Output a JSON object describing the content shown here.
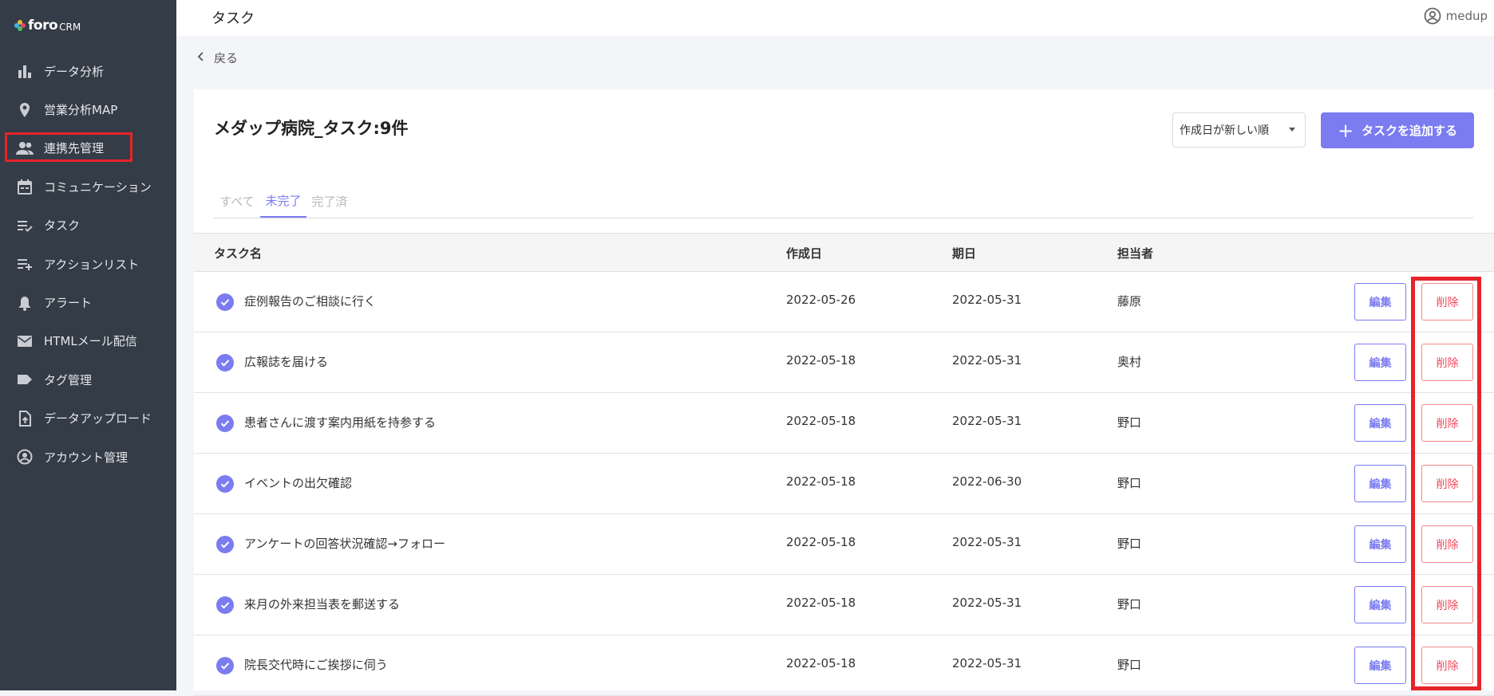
{
  "app": {
    "logo_word": "foro",
    "logo_sub": "CRM"
  },
  "sidebar": {
    "items": [
      {
        "label": "データ分析",
        "icon": "bar-chart-icon"
      },
      {
        "label": "営業分析MAP",
        "icon": "map-pin-icon"
      },
      {
        "label": "連携先管理",
        "icon": "people-icon"
      },
      {
        "label": "コミュニケーション",
        "icon": "calendar-icon"
      },
      {
        "label": "タスク",
        "icon": "checklist-icon"
      },
      {
        "label": "アクションリスト",
        "icon": "playlist-add-icon"
      },
      {
        "label": "アラート",
        "icon": "bell-icon"
      },
      {
        "label": "HTMLメール配信",
        "icon": "mail-icon"
      },
      {
        "label": "タグ管理",
        "icon": "tag-icon"
      },
      {
        "label": "データアップロード",
        "icon": "upload-file-icon"
      },
      {
        "label": "アカウント管理",
        "icon": "account-circle-icon"
      }
    ]
  },
  "header": {
    "title": "タスク",
    "user": "medup"
  },
  "back_label": "戻る",
  "card": {
    "title": "メダップ病院_タスク:9件",
    "sort_value": "作成日が新しい順",
    "add_label": "タスクを追加する"
  },
  "tabs": [
    "すべて",
    "未完了",
    "完了済"
  ],
  "table": {
    "headers": [
      "タスク名",
      "作成日",
      "期日",
      "担当者"
    ],
    "rows": [
      {
        "name": "症例報告のご相談に行く",
        "created": "2022-05-26",
        "due": "2022-05-31",
        "owner": "藤原"
      },
      {
        "name": "広報誌を届ける",
        "created": "2022-05-18",
        "due": "2022-05-31",
        "owner": "奥村"
      },
      {
        "name": "患者さんに渡す案内用紙を持参する",
        "created": "2022-05-18",
        "due": "2022-05-31",
        "owner": "野口"
      },
      {
        "name": "イベントの出欠確認",
        "created": "2022-05-18",
        "due": "2022-06-30",
        "owner": "野口"
      },
      {
        "name": "アンケートの回答状況確認→フォロー",
        "created": "2022-05-18",
        "due": "2022-05-31",
        "owner": "野口"
      },
      {
        "name": "来月の外来担当表を郵送する",
        "created": "2022-05-18",
        "due": "2022-05-31",
        "owner": "野口"
      },
      {
        "name": "院長交代時にご挨拶に伺う",
        "created": "2022-05-18",
        "due": "2022-05-31",
        "owner": "野口"
      }
    ],
    "edit_label": "編集",
    "delete_label": "削除"
  },
  "colors": {
    "sidebar_bg": "#333c47",
    "accent": "#7b7cf0",
    "danger": "#f0485a",
    "highlight": "#e8232a"
  }
}
